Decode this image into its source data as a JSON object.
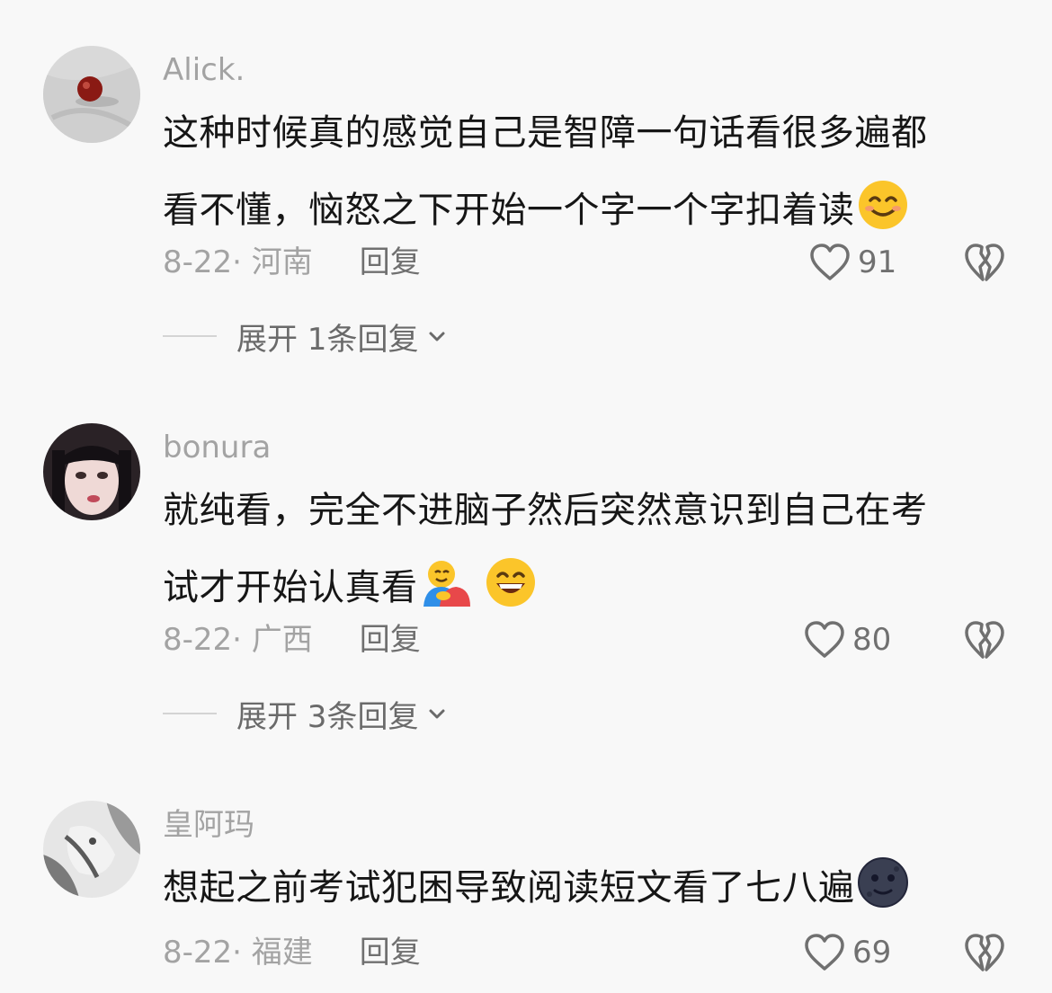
{
  "comments": [
    {
      "username": "Alick.",
      "text_lines": [
        "这种时候真的感觉自己是智障一句话看很多遍都",
        "看不懂，恼怒之下开始一个字一个字扣着读"
      ],
      "emojis": [
        "smiling-face-emoji"
      ],
      "date": "8-22",
      "location": "河南",
      "reply_label": "回复",
      "likes": "91",
      "expand_label": "展开 1条回复"
    },
    {
      "username": "bonura",
      "text_lines": [
        "就纯看，完全不进脑子然后突然意识到自己在考",
        "试才开始认真看"
      ],
      "emojis": [
        "people-hugging-emoji",
        "grinning-face-emoji"
      ],
      "date": "8-22",
      "location": "广西",
      "reply_label": "回复",
      "likes": "80",
      "expand_label": "展开 3条回复"
    },
    {
      "username": "皇阿玛",
      "text_lines": [
        "想起之前考试犯困导致阅读短文看了七八遍"
      ],
      "emojis": [
        "new-moon-face-emoji"
      ],
      "date": "8-22",
      "location": "福建",
      "reply_label": "回复",
      "likes": "69"
    }
  ],
  "colors": {
    "background": "#f8f8f8",
    "username": "#a3a3a3",
    "text": "#161616",
    "meta": "#a3a3a3",
    "action": "#707070"
  }
}
